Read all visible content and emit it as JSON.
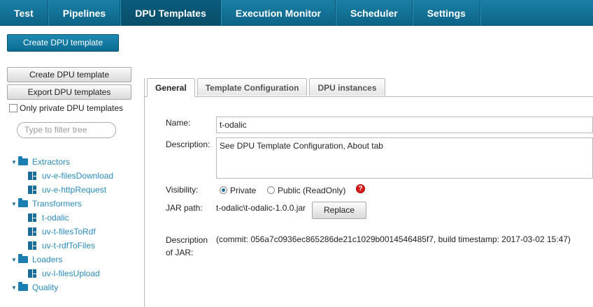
{
  "nav": {
    "items": [
      {
        "label": "Test"
      },
      {
        "label": "Pipelines"
      },
      {
        "label": "DPU Templates"
      },
      {
        "label": "Execution Monitor"
      },
      {
        "label": "Scheduler"
      },
      {
        "label": "Settings"
      }
    ],
    "active": "DPU Templates"
  },
  "toolbar": {
    "create_label": "Create DPU template"
  },
  "sidebar": {
    "create_label": "Create DPU template",
    "export_label": "Export DPU templates",
    "private_label": "Only private DPU templates",
    "filter_placeholder": "Type to filter tree",
    "tree": [
      {
        "label": "Extractors",
        "children": [
          "uv-e-filesDownload",
          "uv-e-httpRequest"
        ]
      },
      {
        "label": "Transformers",
        "children": [
          "t-odalic",
          "uv-t-filesToRdf",
          "uv-t-rdfToFiles"
        ]
      },
      {
        "label": "Loaders",
        "children": [
          "uv-l-filesUpload"
        ]
      },
      {
        "label": "Quality",
        "children": []
      }
    ]
  },
  "tabs": {
    "general": "General",
    "config": "Template Configuration",
    "instances": "DPU instances"
  },
  "form": {
    "name_label": "Name:",
    "name_value": "t-odalic",
    "description_label": "Description:",
    "description_value": "See DPU Template Configuration, About tab",
    "visibility_label": "Visibility:",
    "private_option": "Private",
    "public_option": "Public (ReadOnly)",
    "help_glyph": "?",
    "jar_label": "JAR path:",
    "jar_value": "t-odalic\\t-odalic-1.0.0.jar",
    "replace_label": "Replace",
    "jar_desc_label_1": "Description",
    "jar_desc_label_2": "of JAR:",
    "jar_desc_value": "(commit: 056a7c0936ec865286de21c1029b0014546485f7, build timestamp: 2017-03-02 15:47)"
  },
  "colors": {
    "nav_bg": "#0c6487",
    "tree_text": "#2a8ab8",
    "help_red": "#d91a1a"
  }
}
